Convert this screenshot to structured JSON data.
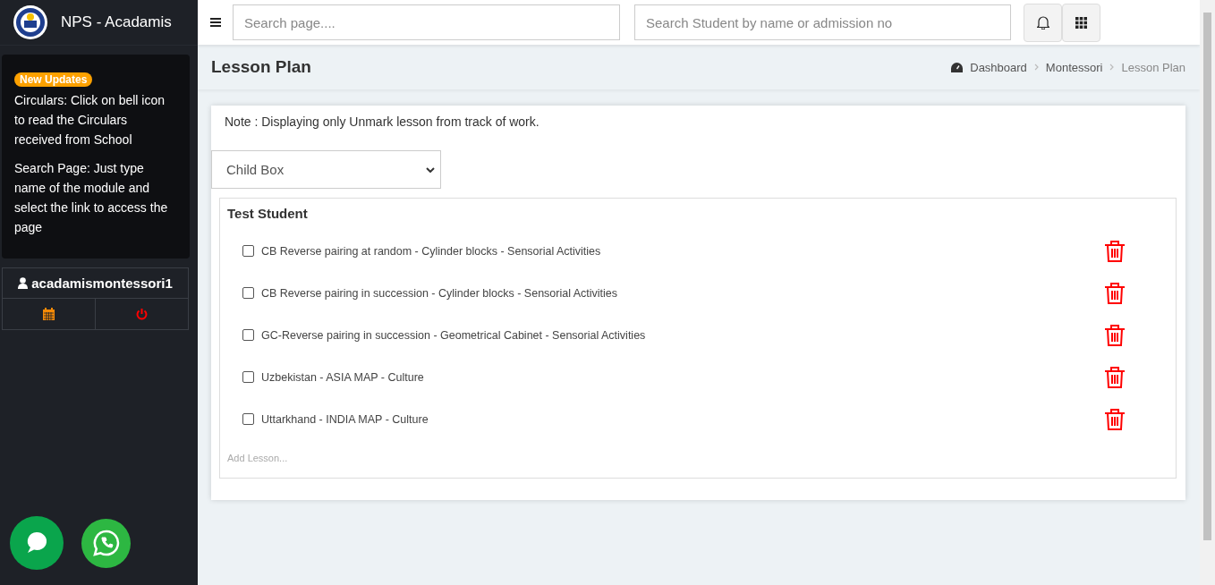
{
  "sidebar": {
    "brand": "NPS - Acadamis",
    "updates": {
      "badge": "New Updates",
      "paragraphs": [
        "Circulars: Click on bell icon to read the Circulars received from School",
        "Search Page: Just type name of the module and select the link to access the page"
      ]
    },
    "user": "acadamismontessori1"
  },
  "topbar": {
    "search_page": {
      "placeholder": "Search page...."
    },
    "search_student": {
      "placeholder": "Search Student by name or admission no"
    }
  },
  "page": {
    "title": "Lesson Plan",
    "breadcrumbs": [
      "Dashboard",
      "Montessori",
      "Lesson Plan"
    ]
  },
  "card": {
    "note": "Note : Displaying only Unmark lesson from track of work.",
    "select": {
      "value": "Child Box"
    },
    "student": "Test Student",
    "lessons": [
      {
        "label": "CB Reverse pairing at random - Cylinder blocks - Sensorial Activities",
        "checked": false
      },
      {
        "label": "CB Reverse pairing in succession - Cylinder blocks - Sensorial Activities",
        "checked": false
      },
      {
        "label": "GC-Reverse pairing in succession - Geometrical Cabinet - Sensorial Activities",
        "checked": false
      },
      {
        "label": "Uzbekistan - ASIA MAP - Culture",
        "checked": false
      },
      {
        "label": "Uttarkhand - INDIA MAP - Culture",
        "checked": false
      }
    ],
    "add_placeholder": "Add Lesson..."
  }
}
